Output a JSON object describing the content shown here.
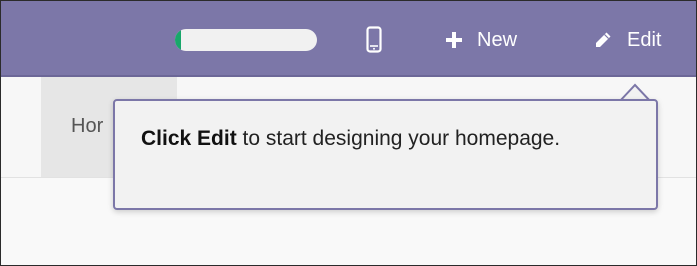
{
  "topbar": {
    "background": "#7c77a8",
    "progress": {
      "value": 0.04,
      "fill_color": "#18a76a"
    },
    "mobile_icon": "mobile-phone-icon",
    "new_button": {
      "icon": "plus-icon",
      "label": "New"
    },
    "edit_button": {
      "icon": "pencil-icon",
      "label": "Edit"
    }
  },
  "nav": {
    "home_tab_label": "Hor"
  },
  "tooltip": {
    "bold_text": "Click Edit",
    "text": " to start designing your homepage.",
    "border_color": "#7c77a8"
  }
}
